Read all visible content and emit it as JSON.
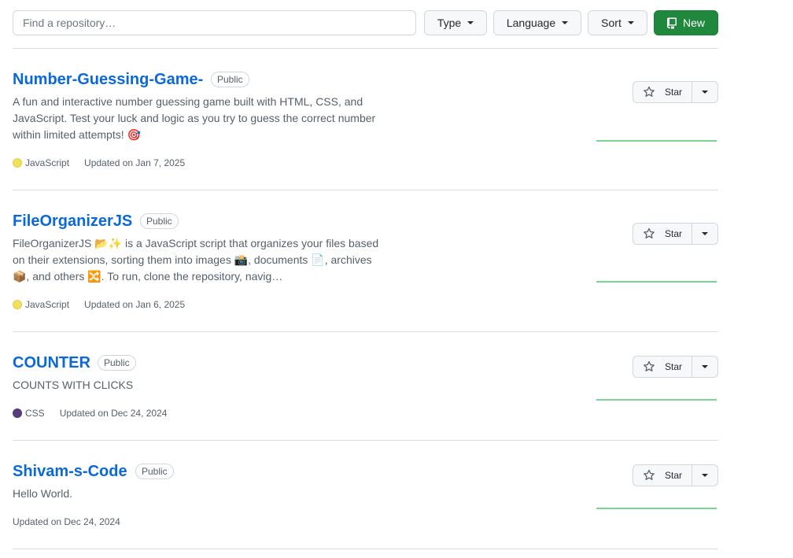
{
  "toolbar": {
    "search_placeholder": "Find a repository…",
    "type_label": "Type",
    "language_label": "Language",
    "sort_label": "Sort",
    "new_label": "New"
  },
  "colors": {
    "link": "#0969da",
    "new_button": "#1f883d",
    "javascript": "#f1e05a",
    "css": "#563d7c",
    "sparkline": "#40c463"
  },
  "repos": [
    {
      "name": "Number-Guessing-Game-",
      "visibility": "Public",
      "description": "A fun and interactive number guessing game built with HTML, CSS, and JavaScript. Test your luck and logic as you try to guess the correct number within limited attempts! 🎯",
      "language": "JavaScript",
      "updated": "Updated on Jan 7, 2025",
      "star_label": "Star"
    },
    {
      "name": "FileOrganizerJS",
      "visibility": "Public",
      "description": "FileOrganizerJS 📂✨ is a JavaScript script that organizes your files based on their extensions, sorting them into images 📸, documents 📄, archives 📦, and others 🔀. To run, clone the repository, navig…",
      "language": "JavaScript",
      "updated": "Updated on Jan 6, 2025",
      "star_label": "Star"
    },
    {
      "name": "COUNTER",
      "visibility": "Public",
      "description": "COUNTS WITH CLICKS",
      "language": "CSS",
      "updated": "Updated on Dec 24, 2024",
      "star_label": "Star"
    },
    {
      "name": "Shivam-s-Code",
      "visibility": "Public",
      "description": "Hello World.",
      "language": "",
      "updated": "Updated on Dec 24, 2024",
      "star_label": "Star"
    }
  ]
}
